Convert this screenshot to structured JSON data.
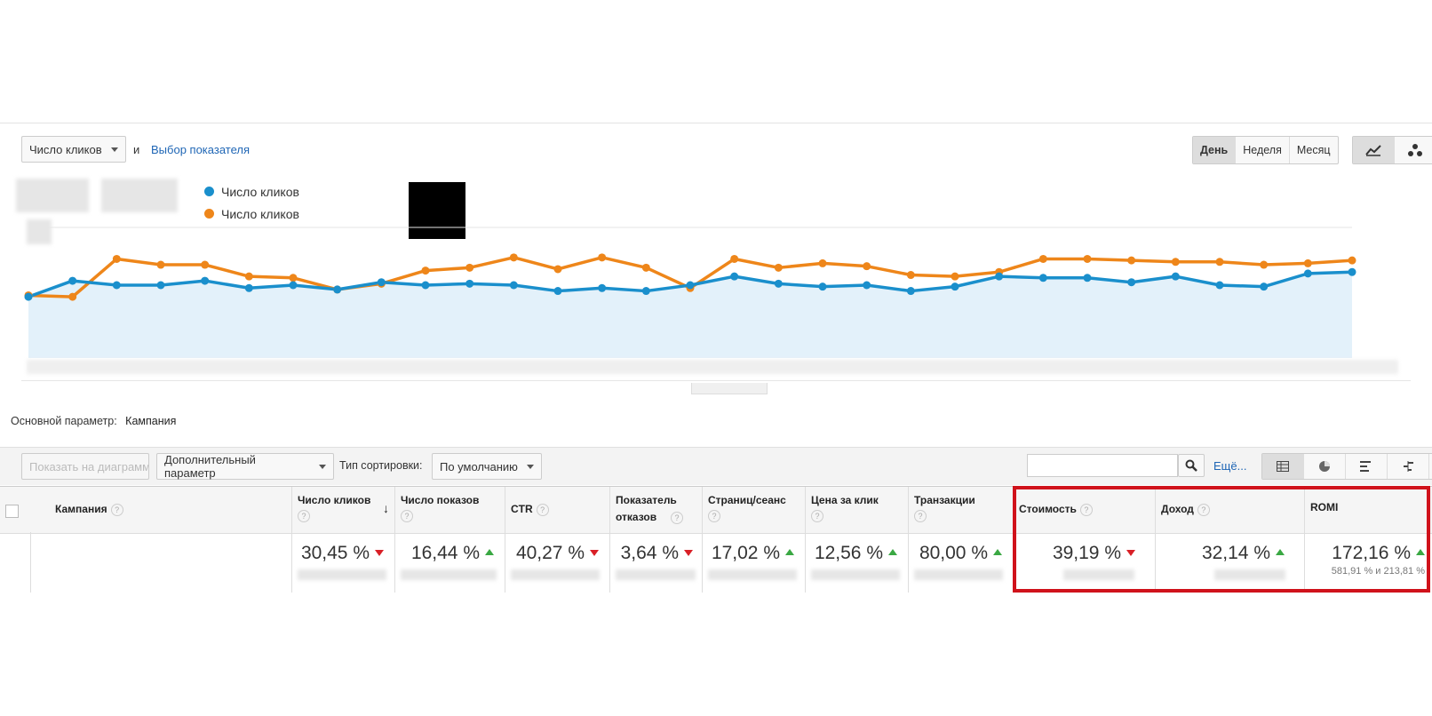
{
  "controls": {
    "metric_select": "Число кликов",
    "and_label": "и",
    "pick_metric_link": "Выбор показателя",
    "period_buttons": [
      "День",
      "Неделя",
      "Месяц"
    ],
    "active_period": "День"
  },
  "colors": {
    "series1": "#1a8fcc",
    "series2": "#ee861a",
    "area": "#e3f1fa",
    "highlight": "#d0121b",
    "up": "#3aa843",
    "down": "#d92027"
  },
  "legend": [
    "Число кликов",
    "Число кликов"
  ],
  "chart_data": {
    "type": "line",
    "series": [
      {
        "name": "Число кликов",
        "values": [
          42,
          53,
          50,
          50,
          53,
          48,
          50,
          47,
          52,
          50,
          51,
          50,
          46,
          48,
          46,
          50,
          56,
          51,
          49,
          50,
          46,
          49,
          56,
          55,
          55,
          52,
          56,
          50,
          49,
          58,
          59
        ]
      },
      {
        "name": "Число кликов",
        "values": [
          43,
          42,
          68,
          64,
          64,
          56,
          55,
          47,
          51,
          60,
          62,
          69,
          61,
          69,
          62,
          48,
          68,
          62,
          65,
          63,
          57,
          56,
          59,
          68,
          68,
          67,
          66,
          66,
          64,
          65,
          67
        ]
      }
    ],
    "ylim": [
      0,
      100
    ]
  },
  "primary_dim": {
    "label": "Основной параметр:",
    "value": "Кампания"
  },
  "toolbar": {
    "show_on_chart": "Показать на диаграмме",
    "secondary_param": "Дополнительный параметр",
    "sort_label": "Тип сортировки:",
    "sort_value": "По умолчанию",
    "search_placeholder": "",
    "more_link": "Ещё..."
  },
  "table": {
    "columns": [
      "Кампания",
      "Число кликов",
      "Число показов",
      "CTR",
      "Показатель отказов",
      "Страниц/сеанс",
      "Цена за клик",
      "Транзакции",
      "Стоимость",
      "Доход",
      "ROMI"
    ],
    "values": [
      "30,45 %",
      "16,44 %",
      "40,27 %",
      "3,64 %",
      "17,02 %",
      "12,56 %",
      "80,00 %",
      "39,19 %",
      "32,14 %",
      "172,16 %"
    ],
    "trends": [
      "down",
      "up",
      "down",
      "down",
      "up",
      "up",
      "up",
      "down",
      "up",
      "up"
    ],
    "romi_sub": "581,91 % и 213,81 %"
  }
}
